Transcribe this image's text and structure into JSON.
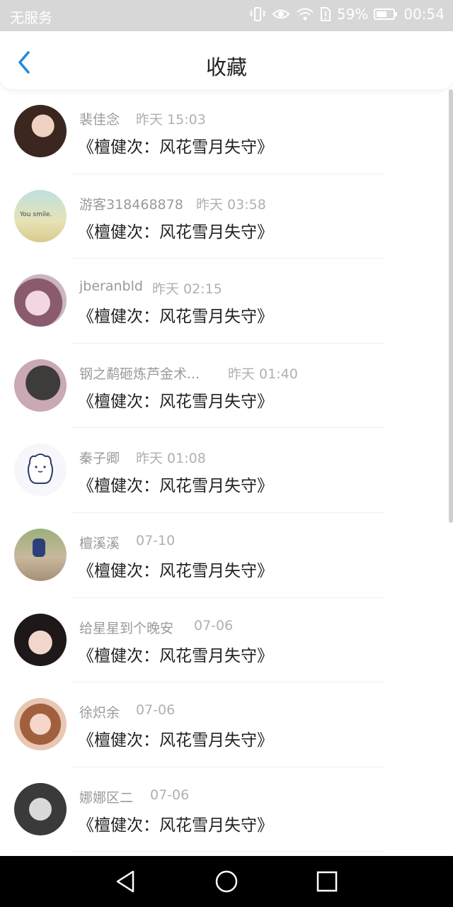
{
  "status_bar": {
    "carrier": "无服务",
    "battery": "59%",
    "time": "00:54"
  },
  "header": {
    "title": "收藏"
  },
  "items": [
    {
      "name": "裴佳念",
      "time": "昨天 15:03",
      "content": "《檀健次：风花雪月失守》",
      "avatar_color": "#6b4b3e"
    },
    {
      "name": "游客318468878",
      "time": "昨天 03:58",
      "content": "《檀健次：风花雪月失守》",
      "avatar_color": "#d8d4a0",
      "avatar_text": "You smile."
    },
    {
      "name": "jberanbld",
      "time": "昨天 02:15",
      "content": "《檀健次：风花雪月失守》",
      "avatar_color": "#b48fa5"
    },
    {
      "name": "钢之鹬砸炼芦金术...",
      "time": "昨天 01:40",
      "content": "《檀健次：风花雪月失守》",
      "avatar_color": "#4a4848"
    },
    {
      "name": "秦子卿",
      "time": "昨天 01:08",
      "content": "《檀健次：风花雪月失守》",
      "avatar_color": "#f3f3f8"
    },
    {
      "name": "檀溪溪",
      "time": "07-10",
      "content": "《檀健次：风花雪月失守》",
      "avatar_color": "#b9a48a"
    },
    {
      "name": "给星星到个晚安",
      "time": "07-06",
      "content": "《檀健次：风花雪月失守》",
      "avatar_color": "#2c2424"
    },
    {
      "name": "徐炽余",
      "time": "07-06",
      "content": "《檀健次：风花雪月失守》",
      "avatar_color": "#d39a8c"
    },
    {
      "name": "娜娜区二",
      "time": "07-06",
      "content": "《檀健次：风花雪月失守》",
      "avatar_color": "#555555"
    }
  ],
  "icons": {
    "back": "chevron-left-icon",
    "nav_back": "triangle-back-icon",
    "nav_home": "circle-home-icon",
    "nav_recents": "square-recents-icon"
  },
  "colors": {
    "accent": "#1e88e5",
    "status_bar_bg": "#d7d7d7"
  }
}
